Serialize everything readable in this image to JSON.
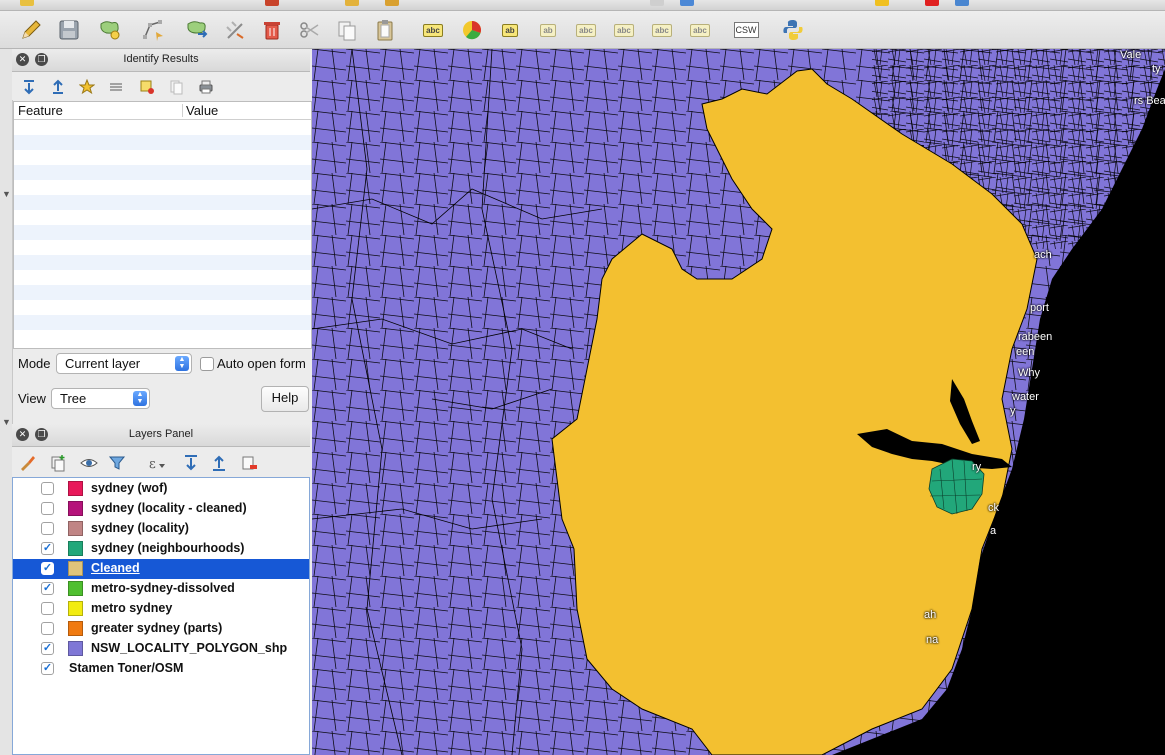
{
  "identify_panel": {
    "title": "Identify Results",
    "columns": [
      "Feature",
      "Value"
    ],
    "mode_label": "Mode",
    "mode_value": "Current layer",
    "auto_open_form_label": "Auto open form",
    "view_label": "View",
    "view_value": "Tree",
    "help_label": "Help"
  },
  "layers_panel": {
    "title": "Layers Panel",
    "layers": [
      {
        "name": "sydney (wof)",
        "checked": false,
        "color": "#e8185a"
      },
      {
        "name": "sydney (locality - cleaned)",
        "checked": false,
        "color": "#b5137a"
      },
      {
        "name": "sydney (locality)",
        "checked": false,
        "color": "#c08585"
      },
      {
        "name": "sydney (neighbourhoods)",
        "checked": true,
        "color": "#22a77a"
      },
      {
        "name": "Cleaned",
        "checked": true,
        "color": "#e0c47b",
        "selected": true
      },
      {
        "name": "metro-sydney-dissolved",
        "checked": true,
        "color": "#4fbf2f"
      },
      {
        "name": "metro sydney",
        "checked": false,
        "color": "#f2ec10"
      },
      {
        "name": "greater sydney (parts)",
        "checked": false,
        "color": "#f07a10"
      },
      {
        "name": "NSW_LOCALITY_POLYGON_shp",
        "checked": true,
        "color": "#7f77d6"
      },
      {
        "name": "Stamen Toner/OSM",
        "checked": true,
        "color": null
      }
    ]
  },
  "toolbar": {
    "csw_label": "CSW"
  },
  "map": {
    "colors": {
      "land": "#8175d8",
      "cleaned": "#f3c030",
      "neighbourhoods": "#22a77a",
      "sea": "#000000"
    },
    "labels": [
      "Vale",
      "ty",
      "rs Bea",
      "ach",
      "port",
      "rabeen",
      "een",
      "Why",
      "water",
      "y",
      "ry",
      "ck",
      "a",
      "ah",
      "na"
    ]
  }
}
